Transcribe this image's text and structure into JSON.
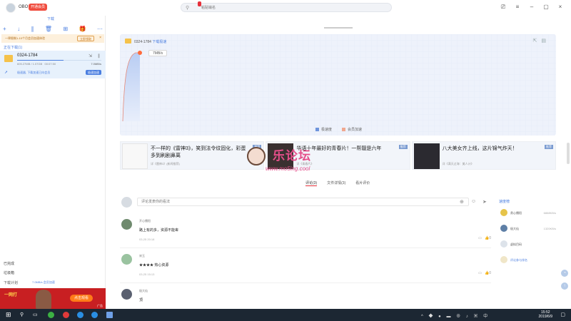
{
  "user": {
    "name": "OBO",
    "vip_badge": "开通会员"
  },
  "search": {
    "placeholder": "粘贴输名"
  },
  "left": {
    "tab_label": "下载",
    "notice": {
      "text": "一律限制1-10个月会员加速体验",
      "button": "立即领取",
      "close": "×"
    },
    "section_downloading": "正在下载(1)",
    "task": {
      "name": "0324-1784",
      "size": "605.27MB / 1.07GB",
      "time": "00:07:50",
      "speed": "7.0MB/s",
      "progress": 0.55,
      "accel_text": "极速器, 下载加速已向会员",
      "accel_button": "极速加速"
    },
    "completed": "已完成",
    "trash": "垃圾箱",
    "plan": "下载计划",
    "plan_speed": "7.0MB/s 会员加速",
    "ad": {
      "brand": "一网打",
      "cta": "点击观看",
      "tag": "广告"
    }
  },
  "chart_panel": {
    "file_name": "0324-1784",
    "category": "下载极速",
    "speed_tag": "7MB/s",
    "legend_1": "极速度",
    "legend_2": "会员加速"
  },
  "ads": [
    {
      "title": "不一样的《雷神3》，笑到法令纹固化，彩蛋多到刷剧鼻离",
      "source": "详《雷神3》(新闻推荐)",
      "tag": "推荐"
    },
    {
      "title": "华语十年最好的青春片！一帮靓是六年",
      "source": "详《青春片》",
      "tag": "推荐"
    },
    {
      "title": "八大美女齐上线，这片锦气炸天！",
      "source": "详《满天过海：美人计》",
      "tag": "推荐"
    }
  ],
  "watermark": {
    "text": "乐论坛",
    "url": "www.mo5ing.cool"
  },
  "tabs": {
    "comments": "评论(3)",
    "file_detail": "文件详情(3)",
    "film_review": "看片评价"
  },
  "comment_input": {
    "placeholder": "评论发表你的看法"
  },
  "comments": [
    {
      "user": "开心播阳",
      "text": "路上有的多，资源不能卑",
      "time": "03-25 20:18"
    },
    {
      "user": "宋玉",
      "text": "★★★★ 热心资源",
      "time": "03-25 15:13"
    },
    {
      "user": "极大仙",
      "text": "顶",
      "time": ""
    }
  ],
  "sidebar_rank": {
    "title": "速度榜",
    "rows": [
      {
        "name": "贵心播阳",
        "value": "6868KB/s"
      },
      {
        "name": "极大仙",
        "value": "1320KB/s"
      },
      {
        "name": "虚拟目码",
        "value": ""
      },
      {
        "name": "评论参与排名",
        "value": ""
      }
    ]
  },
  "taskbar": {
    "time": "15:52",
    "date": "2019/6/9"
  },
  "colors": {
    "accent": "#4a7ee0",
    "danger": "#e6303a",
    "chart_bg": "#eef2fb"
  }
}
